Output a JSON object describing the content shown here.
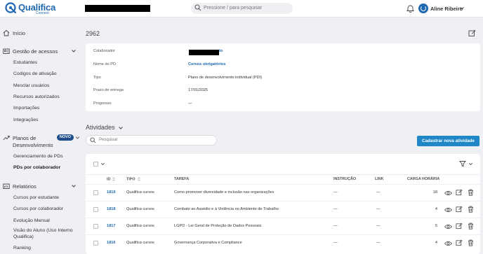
{
  "header": {
    "brand": "Qualifica",
    "brand_sub": "Connect",
    "search_placeholder": "Pressione / para pesquisar",
    "user_name": "Aline Ribeiro"
  },
  "sidebar": {
    "home": "Início",
    "access_group": "Gestão de acessos",
    "access_items": [
      "Estudantes",
      "Codigos de ativação",
      "Mesclar usuários",
      "Recursos autorizados",
      "Importações",
      "Integrações"
    ],
    "plans_group_line1": "Planos de",
    "plans_group_line2": "Desenvolvimento",
    "plans_badge": "NOVO",
    "plans_items": [
      "Gerenciamento de PDs",
      "PDs por colaborador"
    ],
    "reports_group": "Relatórios",
    "reports_items": [
      "Cursos por estudante",
      "Cursos por colaborador",
      "Evolução Mensal",
      "Visão do Aluno (Uso Interno",
      "Qualifica)",
      "Ranking"
    ]
  },
  "main": {
    "page_title": "2962",
    "info": {
      "colaborador_label": "Colaborador",
      "colaborador_suffix": "to",
      "pd_label": "Nome do PD",
      "pd_value": "Cursos obrigatórios",
      "tipo_label": "Tipo",
      "tipo_value": "Plano de desenvolvimento individual (PDI)",
      "prazo_label": "Prazo de entrega",
      "prazo_value": "17/01/2025",
      "progresso_label": "Progresso",
      "progresso_value": "—"
    },
    "activities_title": "Atividades",
    "activities_search_placeholder": "Pesquisar",
    "new_activity_button": "Cadastrar nova atividade",
    "table": {
      "headers": [
        "ID",
        "TIPO",
        "TAREFA",
        "INSTRUÇÃO",
        "LINK",
        "CARGA HORÁRIA"
      ],
      "rows": [
        {
          "id": "1819",
          "tipo": "Qualifica cursos",
          "tarefa": "Como promover diversidade e inclusão nas organizações",
          "instrucao": "—",
          "link": "—",
          "carga": "18"
        },
        {
          "id": "1818",
          "tipo": "Qualifica cursos",
          "tarefa": "Combate ao Assédio e à Violência no Ambiente de Trabalho",
          "instrucao": "—",
          "link": "—",
          "carga": "4"
        },
        {
          "id": "1817",
          "tipo": "Qualifica cursos",
          "tarefa": "LGPD - Lei Geral de Proteção de Dados Pessoais",
          "instrucao": "—",
          "link": "—",
          "carga": "5"
        },
        {
          "id": "1816",
          "tipo": "Qualifica cursos",
          "tarefa": "Governança Corporativa e Compliance",
          "instrucao": "—",
          "link": "—",
          "carga": "4"
        }
      ]
    }
  },
  "colors": {
    "brand": "#1f67b0",
    "primary_button": "#1f86c7",
    "badge": "#1f4e8c"
  }
}
